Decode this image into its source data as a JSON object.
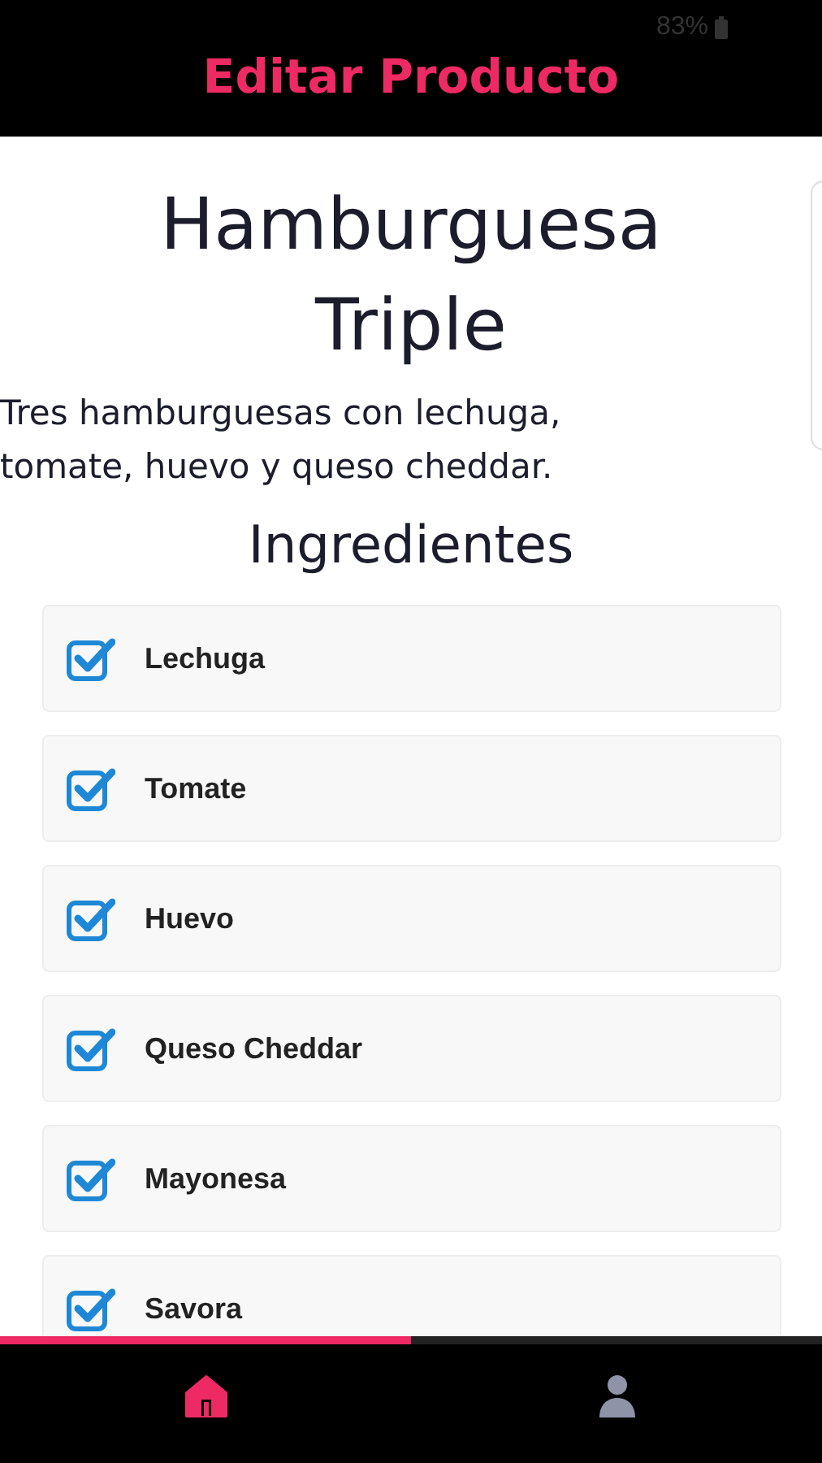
{
  "status_bar": {
    "battery": "83%"
  },
  "header": {
    "title": "Editar Producto"
  },
  "product": {
    "name": "Hamburguesa Triple",
    "description": "Tres hamburguesas con lechuga, tomate, huevo y queso cheddar."
  },
  "ingredients": {
    "heading": "Ingredientes",
    "items": [
      {
        "label": "Lechuga",
        "checked": true
      },
      {
        "label": "Tomate",
        "checked": true
      },
      {
        "label": "Huevo",
        "checked": true
      },
      {
        "label": "Queso Cheddar",
        "checked": true
      },
      {
        "label": "Mayonesa",
        "checked": true
      },
      {
        "label": "Savora",
        "checked": true
      }
    ]
  },
  "bottom_nav": {
    "progress": {
      "level": 0.5
    },
    "items": [
      {
        "kind": "home",
        "selected": true
      },
      {
        "kind": "profile",
        "selected": false
      }
    ]
  }
}
